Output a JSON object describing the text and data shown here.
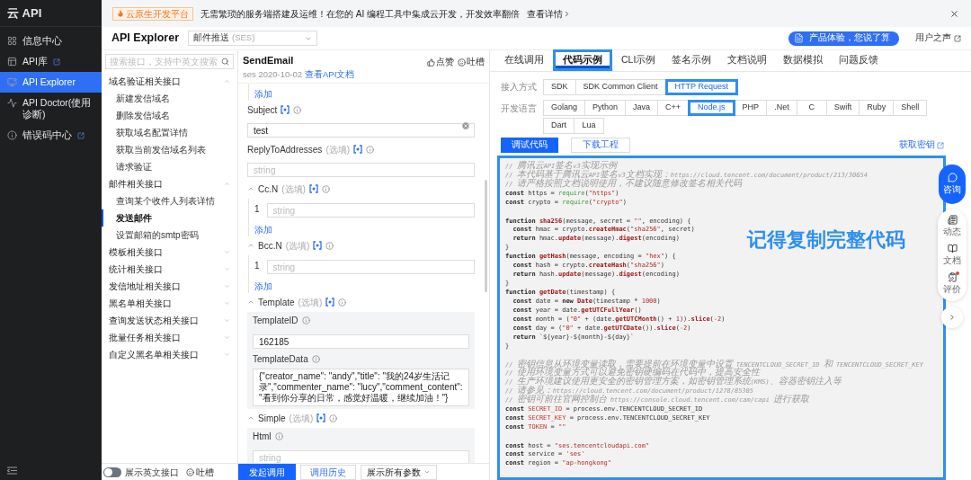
{
  "nav": {
    "brand": "云 API",
    "items": [
      {
        "label": "信息中心",
        "external": false,
        "selected": false
      },
      {
        "label": "API库",
        "external": true,
        "selected": false
      },
      {
        "label": "API Explorer",
        "external": false,
        "selected": true
      },
      {
        "label": "API Doctor(使用诊断)",
        "external": false,
        "selected": false
      },
      {
        "label": "错误码中心",
        "external": true,
        "selected": false
      }
    ]
  },
  "banner": {
    "tag": "云原生开发平台",
    "text": "无需繁琐的服务端搭建及运维！在您的 AI 编程工具中集成云开发，开发效率翻倍",
    "link": "查看详情"
  },
  "header": {
    "title": "API Explorer",
    "product": {
      "value": "邮件推送",
      "suffix": "(SES)"
    },
    "feedback_button": "产品体验，您说了算",
    "voice_link": "用户之声"
  },
  "api_list": {
    "search_placeholder": "搜索接口，支持中英文搜索",
    "groups": [
      {
        "label": "域名验证相关接口",
        "expanded": true,
        "children": [
          {
            "label": "新建发信域名",
            "selected": false
          },
          {
            "label": "删除发信域名",
            "selected": false
          },
          {
            "label": "获取域名配置详情",
            "selected": false
          },
          {
            "label": "获取当前发信域名列表",
            "selected": false
          },
          {
            "label": "请求验证",
            "selected": false
          }
        ]
      },
      {
        "label": "邮件相关接口",
        "expanded": true,
        "children": [
          {
            "label": "查询某个收件人列表详情",
            "selected": false
          },
          {
            "label": "发送邮件",
            "selected": true
          },
          {
            "label": "设置邮箱的smtp密码",
            "selected": false
          }
        ]
      },
      {
        "label": "模板相关接口",
        "expanded": false
      },
      {
        "label": "统计相关接口",
        "expanded": false
      },
      {
        "label": "发信地址相关接口",
        "expanded": false
      },
      {
        "label": "黑名单相关接口",
        "expanded": false
      },
      {
        "label": "查询发送状态相关接口",
        "expanded": false
      },
      {
        "label": "批量任务相关接口",
        "expanded": false
      },
      {
        "label": "自定义黑名单相关接口",
        "expanded": false
      }
    ],
    "english_toggle": {
      "label": "展示英文接口",
      "on": false
    },
    "feedback": "吐槽"
  },
  "api_detail": {
    "name": "SendEmail",
    "version": "ses 2020-10-02",
    "doc_link": "查看API文档",
    "like": "点赞",
    "complain": "吐槽",
    "fields": [
      {
        "kind": "add_link",
        "text": "添加"
      },
      {
        "kind": "text",
        "label": "Subject",
        "value": "test",
        "clearable": true
      },
      {
        "kind": "text",
        "label": "ReplyToAddresses",
        "optional": "(选填)",
        "placeholder": "string"
      },
      {
        "kind": "array",
        "label": "Cc.N",
        "optional": "(选填)",
        "expanded": true,
        "items": [
          {
            "index": "1",
            "placeholder": "string"
          }
        ],
        "add": "添加"
      },
      {
        "kind": "array",
        "label": "Bcc.N",
        "optional": "(选填)",
        "expanded": true,
        "items": [
          {
            "index": "1",
            "placeholder": "string"
          }
        ],
        "add": "添加"
      },
      {
        "kind": "object",
        "label": "Template",
        "optional": "(选填)",
        "expanded": true,
        "fields": [
          {
            "kind": "text",
            "label": "TemplateID",
            "value": "162185"
          },
          {
            "kind": "textarea",
            "label": "TemplateData",
            "value": "{\"creator_name\": \"andy\",\"title\": \"我的24岁生活记录\",\"commenter_name\": \"lucy\",\"comment_content\": \"看到你分享的日常，感觉好温暖，继续加油！\"}"
          }
        ]
      },
      {
        "kind": "object",
        "label": "Simple",
        "optional": "(选填)",
        "expanded": true,
        "fields": [
          {
            "kind": "text",
            "label": "Html",
            "placeholder": "string"
          }
        ]
      }
    ],
    "actions": [
      {
        "label": "发起调用",
        "kind": "primary"
      },
      {
        "label": "调用历史",
        "kind": "secondary"
      },
      {
        "label": "展示所有参数",
        "kind": "dropdown"
      }
    ]
  },
  "code_sample": {
    "tabs": [
      {
        "label": "在线调用",
        "selected": false,
        "highlighted": false
      },
      {
        "label": "代码示例",
        "selected": true,
        "highlighted": true
      },
      {
        "label": "CLI示例",
        "selected": false,
        "highlighted": false
      },
      {
        "label": "签名示例",
        "selected": false,
        "highlighted": false
      },
      {
        "label": "文档说明",
        "selected": false,
        "highlighted": false
      },
      {
        "label": "数据模拟",
        "selected": false,
        "highlighted": false
      },
      {
        "label": "问题反馈",
        "selected": false,
        "highlighted": false
      }
    ],
    "access_label": "接入方式",
    "access_options": [
      {
        "label": "SDK",
        "selected": false,
        "highlighted": false
      },
      {
        "label": "SDK Common Client",
        "selected": false,
        "highlighted": false
      },
      {
        "label": "HTTP Request",
        "selected": true,
        "highlighted": true
      }
    ],
    "language_label": "开发语言",
    "languages": [
      {
        "label": "Golang",
        "selected": false,
        "highlighted": false
      },
      {
        "label": "Python",
        "selected": false,
        "highlighted": false
      },
      {
        "label": "Java",
        "selected": false,
        "highlighted": false
      },
      {
        "label": "C++",
        "selected": false,
        "highlighted": false
      },
      {
        "label": "Node.js",
        "selected": true,
        "highlighted": true
      },
      {
        "label": "PHP",
        "selected": false,
        "highlighted": false
      },
      {
        "label": ".Net",
        "selected": false,
        "highlighted": false
      },
      {
        "label": "C",
        "selected": false,
        "highlighted": false
      },
      {
        "label": "Swift",
        "selected": false,
        "highlighted": false
      },
      {
        "label": "Ruby",
        "selected": false,
        "highlighted": false
      },
      {
        "label": "Shell",
        "selected": false,
        "highlighted": false
      },
      {
        "label": "Dart",
        "selected": false,
        "highlighted": false
      },
      {
        "label": "Lua",
        "selected": false,
        "highlighted": false
      }
    ],
    "code_actions": [
      {
        "label": "调试代码",
        "selected": true
      },
      {
        "label": "下载工程",
        "selected": false
      }
    ],
    "secret_link": "获取密钥",
    "code": {
      "highlighted": true,
      "annotation": "记得复制完整代码",
      "lines": [
        {
          "tokens": [
            {
              "kind": "comment",
              "text": "// 腾讯云API签名v3实现示例"
            }
          ]
        },
        {
          "tokens": [
            {
              "kind": "comment",
              "text": "// 本代码基于腾讯云API签名v3文档实现：https://cloud.tencent.com/document/product/213/30654"
            }
          ]
        },
        {
          "tokens": [
            {
              "kind": "comment",
              "text": "// 请严格按照文档说明使用，不建议随意修改签名相关代码"
            }
          ]
        },
        {
          "tokens": [
            {
              "kind": "kw",
              "text": "const"
            },
            {
              "kind": "plain",
              "text": " https = "
            },
            {
              "kind": "call",
              "text": "require"
            },
            {
              "kind": "plain",
              "text": "("
            },
            {
              "kind": "str",
              "text": "\"https\""
            },
            {
              "kind": "plain",
              "text": ")"
            }
          ]
        },
        {
          "tokens": [
            {
              "kind": "kw",
              "text": "const"
            },
            {
              "kind": "plain",
              "text": " crypto = "
            },
            {
              "kind": "call",
              "text": "require"
            },
            {
              "kind": "plain",
              "text": "("
            },
            {
              "kind": "str",
              "text": "\"crypto\""
            },
            {
              "kind": "plain",
              "text": ")"
            }
          ]
        },
        {
          "space_before": true,
          "tokens": [
            {
              "kind": "kw",
              "text": "function"
            },
            {
              "kind": "fn",
              "text": "sha256",
              "spaced": true
            },
            {
              "kind": "plain",
              "text": "(message, secret = "
            },
            {
              "kind": "str",
              "text": "\"\""
            },
            {
              "kind": "plain",
              "text": ", encoding) {"
            }
          ]
        },
        {
          "indented": true,
          "tokens": [
            {
              "kind": "kw",
              "text": "const"
            },
            {
              "kind": "plain",
              "text": " hmac = crypto."
            },
            {
              "kind": "fn",
              "text": "createHmac"
            },
            {
              "kind": "plain",
              "text": "("
            },
            {
              "kind": "str",
              "text": "\"sha256\""
            },
            {
              "kind": "plain",
              "text": ", secret)"
            }
          ]
        },
        {
          "indented": true,
          "tokens": [
            {
              "kind": "kw",
              "text": "return"
            },
            {
              "kind": "plain",
              "text": " hmac."
            },
            {
              "kind": "fn",
              "text": "update"
            },
            {
              "kind": "plain",
              "text": "(message)."
            },
            {
              "kind": "fn",
              "text": "digest"
            },
            {
              "kind": "plain",
              "text": "(encoding)"
            }
          ]
        },
        {
          "tokens": [
            {
              "kind": "plain",
              "text": "}"
            }
          ]
        },
        {
          "tokens": [
            {
              "kind": "kw",
              "text": "function"
            },
            {
              "kind": "fn",
              "text": "getHash",
              "spaced": true
            },
            {
              "kind": "plain",
              "text": "(message, encoding = "
            },
            {
              "kind": "str",
              "text": "\"hex\""
            },
            {
              "kind": "plain",
              "text": ") {"
            }
          ]
        },
        {
          "indented": true,
          "tokens": [
            {
              "kind": "kw",
              "text": "const"
            },
            {
              "kind": "plain",
              "text": " hash = crypto."
            },
            {
              "kind": "fn",
              "text": "createHash"
            },
            {
              "kind": "plain",
              "text": "("
            },
            {
              "kind": "str",
              "text": "\"sha256\""
            },
            {
              "kind": "plain",
              "text": ")"
            }
          ]
        },
        {
          "indented": true,
          "tokens": [
            {
              "kind": "kw",
              "text": "return"
            },
            {
              "kind": "plain",
              "text": " hash."
            },
            {
              "kind": "fn",
              "text": "update"
            },
            {
              "kind": "plain",
              "text": "(message)."
            },
            {
              "kind": "fn",
              "text": "digest"
            },
            {
              "kind": "plain",
              "text": "(encoding)"
            }
          ]
        },
        {
          "tokens": [
            {
              "kind": "plain",
              "text": "}"
            }
          ]
        },
        {
          "tokens": [
            {
              "kind": "kw",
              "text": "function"
            },
            {
              "kind": "fn",
              "text": "getDate",
              "spaced": true
            },
            {
              "kind": "plain",
              "text": "(timestamp) {"
            }
          ]
        },
        {
          "indented": true,
          "tokens": [
            {
              "kind": "kw",
              "text": "const"
            },
            {
              "kind": "plain",
              "text": " date = "
            },
            {
              "kind": "kw",
              "text": "new"
            },
            {
              "kind": "fn",
              "text": "Date",
              "spaced": true
            },
            {
              "kind": "plain",
              "text": "(timestamp * "
            },
            {
              "kind": "str",
              "text": "1000"
            },
            {
              "kind": "plain",
              "text": ")"
            }
          ]
        },
        {
          "indented": true,
          "tokens": [
            {
              "kind": "kw",
              "text": "const"
            },
            {
              "kind": "plain",
              "text": " year = date."
            },
            {
              "kind": "fn",
              "text": "getUTCFullYear"
            },
            {
              "kind": "plain",
              "text": "()"
            }
          ]
        },
        {
          "indented": true,
          "tokens": [
            {
              "kind": "kw",
              "text": "const"
            },
            {
              "kind": "plain",
              "text": " month = ("
            },
            {
              "kind": "str",
              "text": "\"0\""
            },
            {
              "kind": "plain",
              "text": " + (date."
            },
            {
              "kind": "fn",
              "text": "getUTCMonth"
            },
            {
              "kind": "plain",
              "text": "() + "
            },
            {
              "kind": "str",
              "text": "1"
            },
            {
              "kind": "plain",
              "text": "))."
            },
            {
              "kind": "fn",
              "text": "slice"
            },
            {
              "kind": "plain",
              "text": "("
            },
            {
              "kind": "str",
              "text": "-2"
            },
            {
              "kind": "plain",
              "text": ")"
            }
          ]
        },
        {
          "indented": true,
          "tokens": [
            {
              "kind": "kw",
              "text": "const"
            },
            {
              "kind": "plain",
              "text": " day = ("
            },
            {
              "kind": "str",
              "text": "\"0\""
            },
            {
              "kind": "plain",
              "text": " + date."
            },
            {
              "kind": "fn",
              "text": "getUTCDate"
            },
            {
              "kind": "plain",
              "text": "())."
            },
            {
              "kind": "fn",
              "text": "slice"
            },
            {
              "kind": "plain",
              "text": "("
            },
            {
              "kind": "str",
              "text": "-2"
            },
            {
              "kind": "plain",
              "text": ")"
            }
          ]
        },
        {
          "indented": true,
          "tokens": [
            {
              "kind": "kw",
              "text": "return"
            },
            {
              "kind": "plain",
              "text": " `${year}-${month}-${day}`"
            }
          ]
        },
        {
          "tokens": [
            {
              "kind": "plain",
              "text": "}"
            }
          ]
        },
        {
          "space_before": true,
          "tokens": [
            {
              "kind": "comment",
              "text": "// 密钥信息从环境变量读取，需要提前在环境变量中设置 TENCENTCLOUD_SECRET_ID 和 TENCENTCLOUD_SECRET_KEY"
            }
          ]
        },
        {
          "tokens": [
            {
              "kind": "comment",
              "text": "// 使用环境变量方式可以避免密钥硬编码在代码中，提高安全性"
            }
          ]
        },
        {
          "tokens": [
            {
              "kind": "comment",
              "text": "// 生产环境建议使用更安全的密钥管理方案，如密钥管理系统(KMS)、容器密钥注入等"
            }
          ]
        },
        {
          "tokens": [
            {
              "kind": "comment",
              "text": "// 请参见：https://cloud.tencent.com/document/product/1278/85305"
            }
          ]
        },
        {
          "tokens": [
            {
              "kind": "comment",
              "text": "// 密钥可前往官网控制台 https://console.cloud.tencent.com/cam/capi 进行获取"
            }
          ]
        },
        {
          "tokens": [
            {
              "kind": "kw",
              "text": "const"
            },
            {
              "kind": "var",
              "text": "SECRET_ID",
              "spaced": true
            },
            {
              "kind": "plain",
              "text": " = process.env.TENCENTCLOUD_SECRET_ID"
            }
          ]
        },
        {
          "tokens": [
            {
              "kind": "kw",
              "text": "const"
            },
            {
              "kind": "var",
              "text": "SECRET_KEY",
              "spaced": true
            },
            {
              "kind": "plain",
              "text": " = process.env.TENCENTCLOUD_SECRET_KEY"
            }
          ]
        },
        {
          "tokens": [
            {
              "kind": "kw",
              "text": "const"
            },
            {
              "kind": "var",
              "text": "TOKEN",
              "spaced": true
            },
            {
              "kind": "plain",
              "text": " = "
            },
            {
              "kind": "str",
              "text": "\"\""
            }
          ]
        },
        {
          "space_before": true,
          "tokens": [
            {
              "kind": "kw",
              "text": "const"
            },
            {
              "kind": "plain",
              "text": " host = "
            },
            {
              "kind": "str",
              "text": "\"ses.tencentcloudapi.com\""
            }
          ]
        },
        {
          "tokens": [
            {
              "kind": "kw",
              "text": "const"
            },
            {
              "kind": "plain",
              "text": " service = "
            },
            {
              "kind": "str",
              "text": "'ses'"
            }
          ]
        },
        {
          "tokens": [
            {
              "kind": "kw",
              "text": "const"
            },
            {
              "kind": "plain",
              "text": " region = "
            },
            {
              "kind": "str",
              "text": "\"ap-hongkong\""
            }
          ]
        }
      ]
    }
  },
  "float_toolbar": [
    {
      "kind": "consult",
      "label": "咨询"
    },
    {
      "kind": "news",
      "label": "动态"
    },
    {
      "kind": "docs",
      "label": "文档"
    },
    {
      "kind": "review",
      "label": "评价",
      "badge": true
    },
    {
      "kind": "collapse"
    }
  ]
}
